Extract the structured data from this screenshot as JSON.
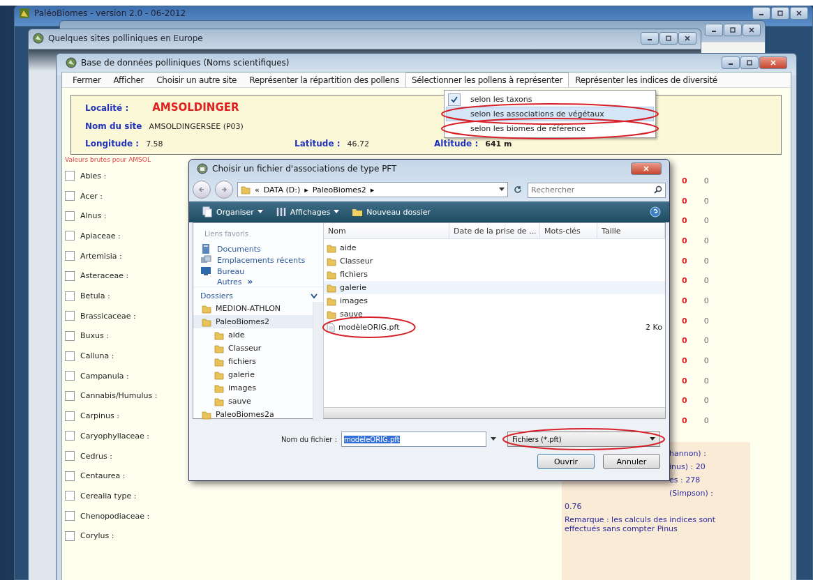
{
  "back_window": {
    "title": "PaléoBiomes - version 2.0 - 06-2012"
  },
  "middle_window": {
    "title": "Quelques sites polliniques en Europe"
  },
  "main_window": {
    "title": "Base de données polliniques (Noms scientifiques)",
    "menu": [
      {
        "label": "Fermer",
        "selected": false
      },
      {
        "label": "Afficher",
        "selected": false
      },
      {
        "label": "Choisir un autre site",
        "selected": false
      },
      {
        "label": "Représenter la répartition des pollens",
        "selected": false
      },
      {
        "label": "Sélectionner les pollens à représenter",
        "selected": true
      },
      {
        "label": "Représenter les indices de diversité",
        "selected": false
      }
    ],
    "site_info": [
      {
        "label": "Localité :",
        "value": "AMSOLDINGER",
        "kind": "title"
      },
      {
        "label": "Nom du site",
        "value": "AMSOLDINGERSEE (P03)",
        "kind": "plain"
      },
      {
        "label": "Longitude :",
        "value": "7.58",
        "kind": "plain"
      },
      {
        "label": "Latitude :",
        "value": "46.72",
        "kind": "plain"
      },
      {
        "label": "Altitude :",
        "value": "641 m",
        "kind": "bold"
      }
    ],
    "dropdown": [
      {
        "label": "selon les taxons",
        "checked": true,
        "selected": false
      },
      {
        "label": "selon les associations de végétaux",
        "checked": false,
        "selected": true
      },
      {
        "label": "selon les biomes de référence",
        "checked": false,
        "selected": false
      }
    ],
    "raw_values_label": "Valeurs brutes pour AMSOL",
    "taxa": [
      {
        "name": "Abies :",
        "checked": false,
        "values": [
          "0",
          "0"
        ]
      },
      {
        "name": "Acer :",
        "checked": false,
        "values": [
          "0",
          "0"
        ]
      },
      {
        "name": "Alnus :",
        "checked": false,
        "values": [
          "0",
          "0"
        ]
      },
      {
        "name": "Apiaceae :",
        "checked": false,
        "values": [
          "0",
          "0"
        ]
      },
      {
        "name": "Artemisia :",
        "checked": false,
        "values": [
          "0",
          "0"
        ]
      },
      {
        "name": "Asteraceae :",
        "checked": false,
        "values": [
          "0",
          "0"
        ]
      },
      {
        "name": "Betula :",
        "checked": false,
        "values": [
          "0",
          "0"
        ]
      },
      {
        "name": "Brassicaceae :",
        "checked": false,
        "values": [
          "0",
          "0"
        ]
      },
      {
        "name": "Buxus :",
        "checked": false,
        "values": [
          "0",
          "0"
        ]
      },
      {
        "name": "Calluna :",
        "checked": false,
        "values": [
          "0",
          "0"
        ]
      },
      {
        "name": "Campanula :",
        "checked": false,
        "values": [
          "0",
          "0"
        ]
      },
      {
        "name": "Cannabis/Humulus :",
        "checked": false,
        "values": [
          "0",
          "0"
        ]
      },
      {
        "name": "Carpinus :",
        "checked": false,
        "values": [
          "0",
          "0"
        ]
      },
      {
        "name": "Caryophyllaceae :",
        "checked": false
      },
      {
        "name": "Cedrus :",
        "checked": false
      },
      {
        "name": "Centaurea :",
        "checked": false
      },
      {
        "name": "Cerealia type :",
        "checked": false
      },
      {
        "name": "Chenopodiaceae :",
        "checked": false
      },
      {
        "name": "Corylus :",
        "checked": false
      }
    ],
    "indices_panel": [
      {
        "text": "hannon) :",
        "kind": "cut"
      },
      {
        "text": "inus) : 20",
        "kind": "cut"
      },
      {
        "text": "es : 278",
        "kind": "cut"
      },
      {
        "text": "(Simpson) :",
        "kind": "cut"
      },
      {
        "text": "0.76",
        "kind": "full"
      },
      {
        "text": "Remarque : les calculs des indices sont effectués sans compter Pinus",
        "kind": "full"
      }
    ]
  },
  "dialog": {
    "title": "Choisir un fichier d'associations de type PFT",
    "breadcrumb": [
      "«",
      "DATA (D:)",
      "▸",
      "PaleoBiomes2",
      "▸"
    ],
    "search": {
      "placeholder": "Rechercher"
    },
    "toolbar": [
      "Organiser",
      "Affichages",
      "Nouveau dossier"
    ],
    "favorites_heading": "Liens favoris",
    "favorites": [
      "Documents",
      "Emplacements récents",
      "Bureau"
    ],
    "more": "Autres",
    "more_mark": "»",
    "folders_heading": "Dossiers",
    "tree": [
      {
        "label": "MEDION-ATHLON",
        "selected": false
      },
      {
        "label": "PaleoBiomes2",
        "selected": true,
        "children": [
          {
            "label": "aide",
            "selected": false
          },
          {
            "label": "Classeur",
            "selected": false
          },
          {
            "label": "fichiers",
            "selected": false
          },
          {
            "label": "galerie",
            "selected": false
          },
          {
            "label": "images",
            "selected": false
          },
          {
            "label": "sauve",
            "selected": false
          }
        ]
      },
      {
        "label": "PaleoBiomes2a",
        "selected": false
      }
    ],
    "columns": [
      "Nom",
      "Date de la prise de ...",
      "Mots-clés",
      "Taille"
    ],
    "files": [
      {
        "name": "aide",
        "kind": "folder",
        "hovered": false
      },
      {
        "name": "Classeur",
        "kind": "folder",
        "hovered": false
      },
      {
        "name": "fichiers",
        "kind": "folder",
        "hovered": false
      },
      {
        "name": "galerie",
        "kind": "folder",
        "hovered": true
      },
      {
        "name": "images",
        "kind": "folder",
        "hovered": false
      },
      {
        "name": "sauve",
        "kind": "folder",
        "hovered": false
      },
      {
        "name": "modèleORIG.pft",
        "kind": "file",
        "size": "2 Ko",
        "hovered": false
      }
    ],
    "filename_label": "Nom du fichier :",
    "filename": "modèleORIG.pft",
    "filetype": "Fichiers  (*.pft)",
    "buttons": [
      "Ouvrir",
      "Annuler"
    ]
  }
}
